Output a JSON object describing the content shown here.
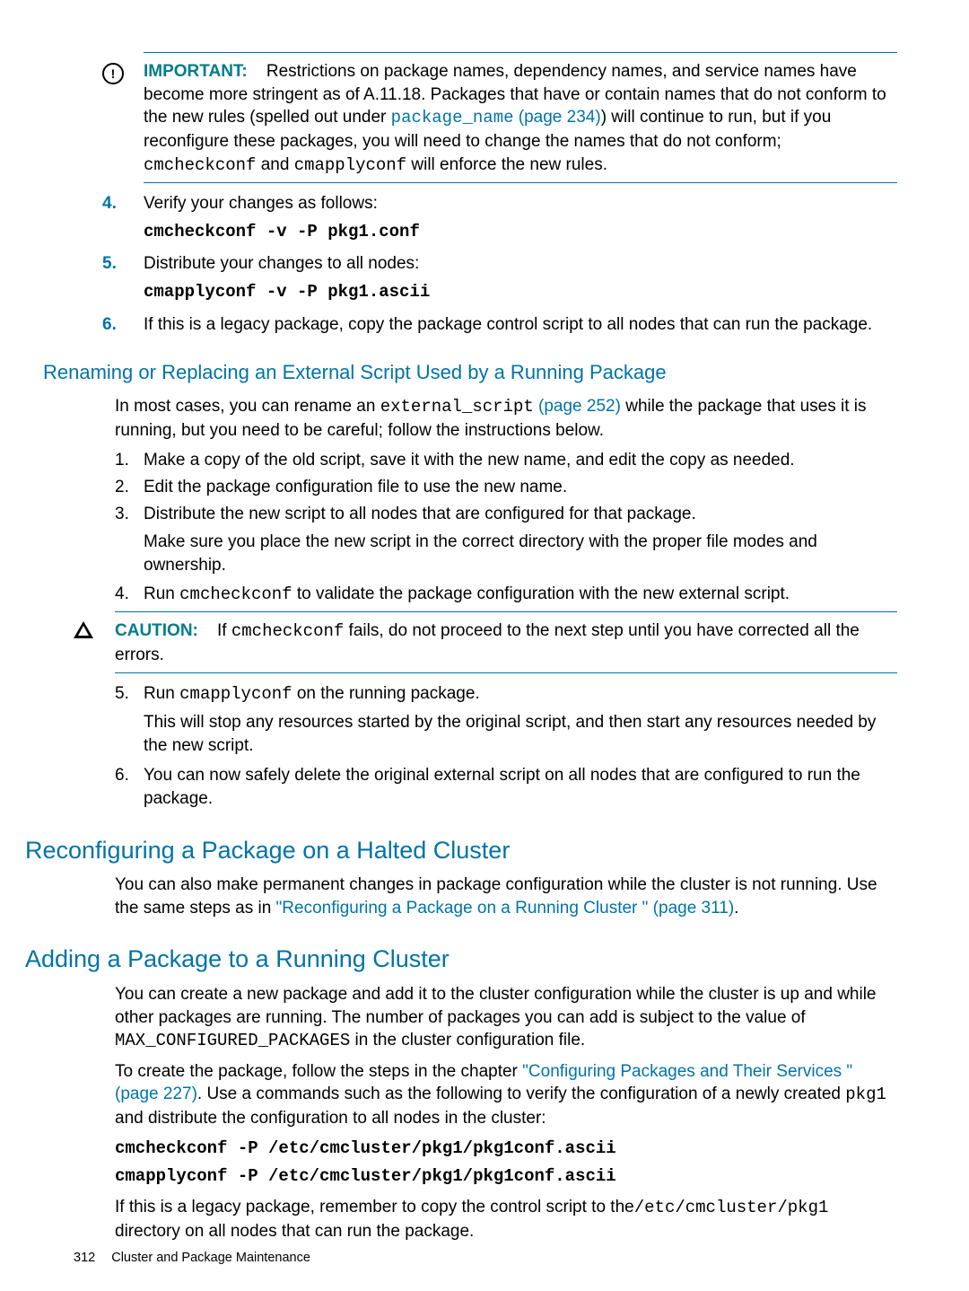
{
  "important": {
    "label": "IMPORTANT:",
    "body_1": "Restrictions on package names, dependency names, and service names have become more stringent as of A.11.18. Packages that have or contain names that do not conform to the new rules (spelled out under ",
    "link_code": "package_name",
    "link_page": " (page 234)",
    "body_2": ") will continue to run, but if you reconfigure these packages, you will need to change the names that do not conform; ",
    "code1": "cmcheckconf",
    "mid": " and ",
    "code2": "cmapplyconf",
    "body_3": " will enforce the new rules."
  },
  "steps_top": {
    "s4_num": "4.",
    "s4_text": "Verify your changes as follows:",
    "s4_cmd": "cmcheckconf -v -P pkg1.conf",
    "s5_num": "5.",
    "s5_text": "Distribute your changes to all nodes:",
    "s5_cmd": "cmapplyconf -v -P pkg1.ascii",
    "s6_num": "6.",
    "s6_text": "If this is a legacy package, copy the package control script to all nodes that can run the package."
  },
  "h3_rename": "Renaming or Replacing an External Script Used by a Running Package",
  "rename_intro_1": "In most cases, you can rename an ",
  "rename_code": "external_script",
  "rename_link_page": " (page 252)",
  "rename_intro_2": " while the package that uses it is running, but you need to be careful; follow the instructions below.",
  "rename_steps": {
    "s1n": "1.",
    "s1": "Make a copy of the old script, save it with the new name, and edit the copy as needed.",
    "s2n": "2.",
    "s2": "Edit the package configuration file to use the new name.",
    "s3n": "3.",
    "s3": "Distribute the new script to all nodes that are configured for that package.",
    "s3b": "Make sure you place the new script in the correct directory with the proper file modes and ownership.",
    "s4n": "4.",
    "s4a": "Run ",
    "s4code": "cmcheckconf",
    "s4b": " to validate the package configuration with the new external script."
  },
  "caution": {
    "label": "CAUTION:",
    "a": "If ",
    "code": "cmcheckconf",
    "b": " fails, do not proceed to the next step until you have corrected all the errors."
  },
  "rename_steps2": {
    "s5n": "5.",
    "s5a": "Run ",
    "s5code": "cmapplyconf",
    "s5b": " on the running package.",
    "s5c": "This will stop any resources started by the original script, and then start any resources needed by the new script.",
    "s6n": "6.",
    "s6": "You can now safely delete the original external script on all nodes that are configured to run the package."
  },
  "h2_halted": "Reconfiguring a Package on a Halted Cluster",
  "halted_p1": "You can also make permanent changes in package configuration while the cluster is not running. Use the same steps as in ",
  "halted_link": "\"Reconfiguring a Package on a Running Cluster \" (page 311)",
  "halted_p2": ".",
  "h2_adding": "Adding a Package to a Running Cluster",
  "adding_p1a": "You can create a new package and add it to the cluster configuration while the cluster is up and while other packages are running. The number of packages you can add is subject to the value of ",
  "adding_code1": "MAX_CONFIGURED_PACKAGES",
  "adding_p1b": " in the cluster configuration file.",
  "adding_p2a": "To create the package, follow the steps in the chapter ",
  "adding_link": "\"Configuring Packages and Their Services \" (page 227)",
  "adding_p2b": ". Use a commands such as the following to verify the configuration of a newly created ",
  "adding_code2": "pkg1",
  "adding_p2c": " and distribute the configuration to all nodes in the cluster:",
  "adding_cmd1": "cmcheckconf -P /etc/cmcluster/pkg1/pkg1conf.ascii",
  "adding_cmd2": "cmapplyconf -P /etc/cmcluster/pkg1/pkg1conf.ascii",
  "adding_p3a": "If this is a legacy package, remember to copy the control script to the",
  "adding_code3": "/etc/cmcluster/pkg1",
  "adding_p3b": " directory on all nodes that can run the package.",
  "footer_page": "312",
  "footer_text": "Cluster and Package Maintenance"
}
